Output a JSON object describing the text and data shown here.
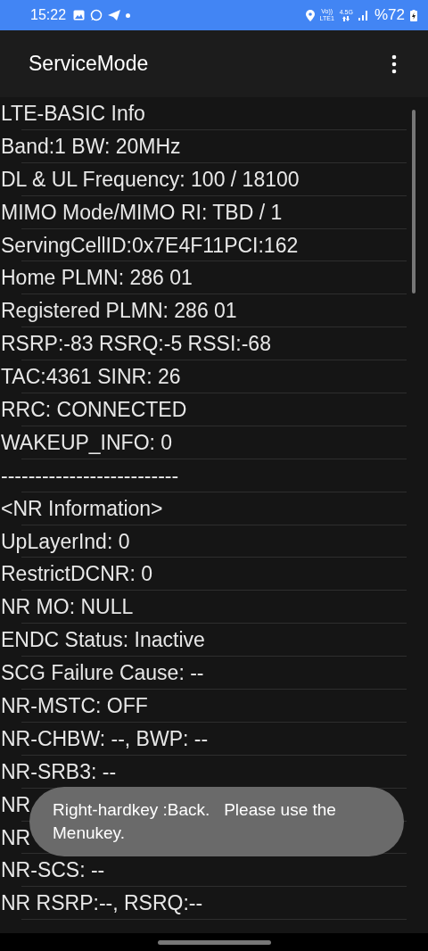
{
  "status_bar": {
    "time": "15:22",
    "volte_top": "Vo))",
    "volte_bottom": "LTE1",
    "network": "4.5G",
    "battery": "%72"
  },
  "app_bar": {
    "title": "ServiceMode"
  },
  "rows": [
    "LTE-BASIC Info",
    "Band:1 BW: 20MHz",
    "DL & UL Frequency: 100 / 18100",
    "MIMO Mode/MIMO RI: TBD / 1",
    "ServingCellID:0x7E4F11PCI:162",
    "Home PLMN: 286 01",
    "Registered PLMN: 286 01",
    "RSRP:-83 RSRQ:-5 RSSI:-68",
    "TAC:4361 SINR: 26",
    "RRC: CONNECTED",
    "WAKEUP_INFO: 0",
    "--------------------------",
    "<NR Information>",
    "UpLayerInd: 0",
    "RestrictDCNR: 0",
    "NR MO: NULL",
    "ENDC Status: Inactive",
    "SCG Failure Cause: --",
    "NR-MSTC: OFF",
    "NR-CHBW: --, BWP: --",
    "NR-SRB3: --",
    "NR",
    "NR",
    "NR-SCS: --",
    "NR RSRP:--, RSRQ:--"
  ],
  "toast": {
    "message": "Right-hardkey :Back.   Please use the Menukey."
  }
}
